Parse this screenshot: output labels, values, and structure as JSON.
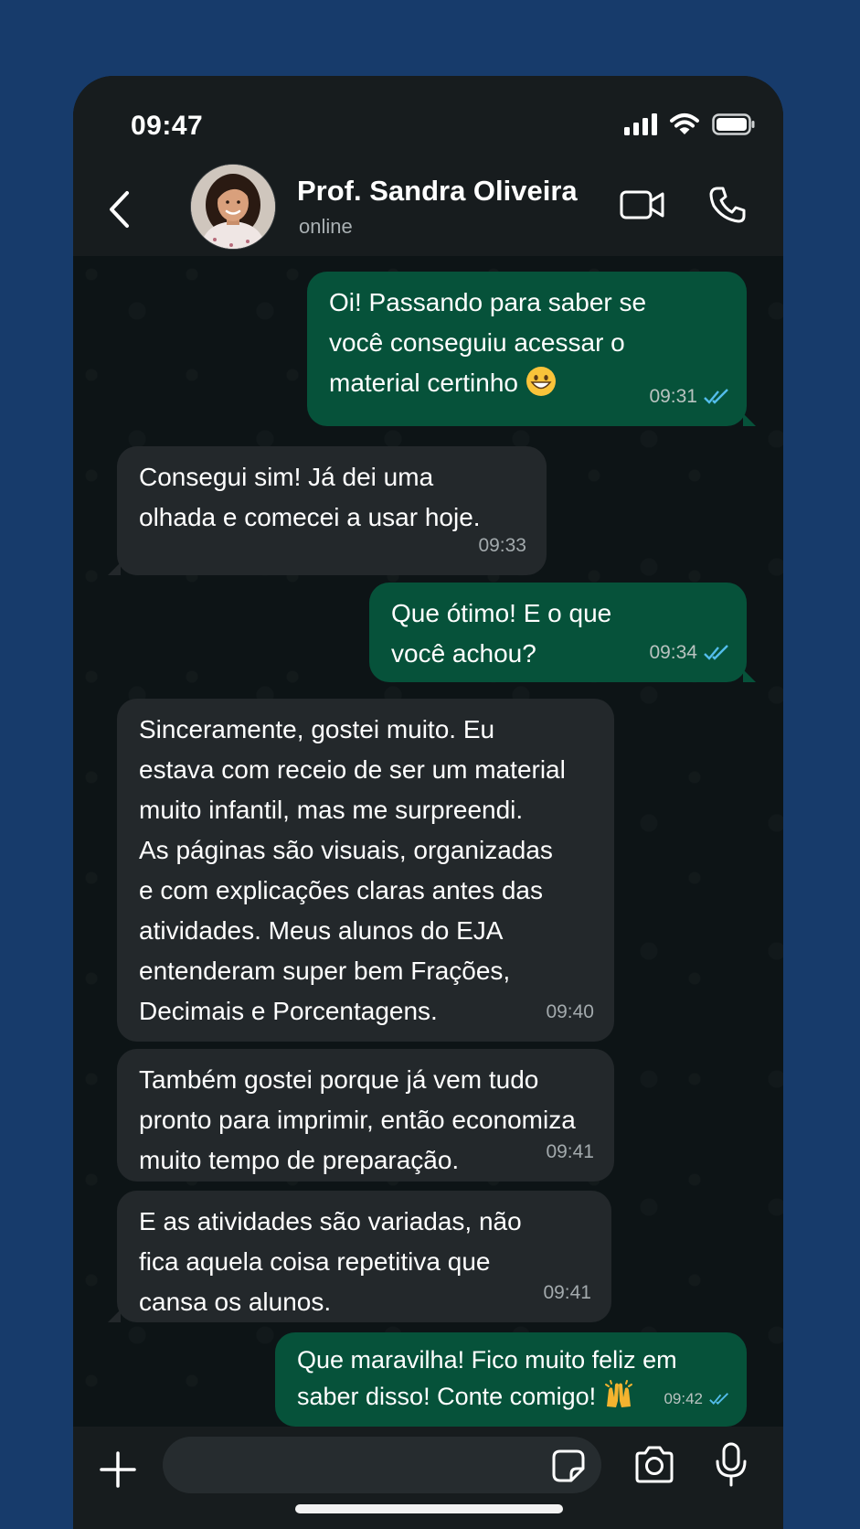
{
  "status_bar": {
    "time": "09:47"
  },
  "header": {
    "contact_name": "Prof. Sandra Oliveira",
    "presence": "online"
  },
  "messages": [
    {
      "dir": "out",
      "text": "Oi! Passando para saber se\nvocê conseguiu acessar o\nmaterial certinho",
      "emoji": "grinning-face",
      "time": "09:31",
      "read": true
    },
    {
      "dir": "in",
      "text": "Consegui sim! Já dei uma\nolhada e comecei a usar hoje.",
      "time": "09:33"
    },
    {
      "dir": "out",
      "text": "Que ótimo! E o que\nvocê achou?",
      "time": "09:34",
      "read": true
    },
    {
      "dir": "in",
      "text": "Sinceramente, gostei muito. Eu\nestava com receio de ser um material\nmuito infantil, mas me surpreendi.\nAs páginas são visuais, organizadas\ne com explicações claras antes das\natividades. Meus alunos do EJA\nentenderam super bem Frações,\nDecimais e Porcentagens.",
      "time": "09:40"
    },
    {
      "dir": "in",
      "text": "Também gostei porque já vem tudo\npronto para imprimir, então economiza\nmuito tempo de preparação.",
      "time": "09:41"
    },
    {
      "dir": "in",
      "text": "E as atividades são variadas, não\nfica aquela coisa repetitiva que\ncansa os alunos.",
      "time": "09:41"
    },
    {
      "dir": "out",
      "text": "Que maravilha! Fico muito feliz em\nsaber disso! Conte comigo!",
      "emoji": "raising-hands",
      "time": "09:42",
      "read": true
    }
  ],
  "composer": {
    "placeholder": ""
  },
  "colors": {
    "background": "#173b6b",
    "outgoing_bubble": "#06523a",
    "incoming_bubble": "#23282b",
    "read_ticks": "#53bdeb"
  }
}
